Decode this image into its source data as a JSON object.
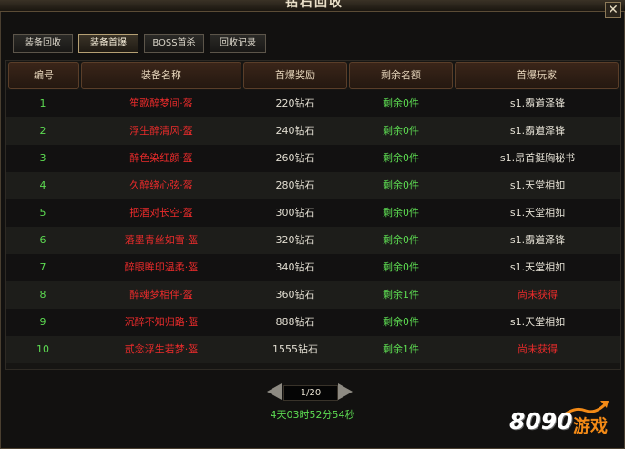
{
  "window": {
    "title": "钻石回收",
    "close_symbol": "✕"
  },
  "tabs": [
    {
      "label": "装备回收",
      "active": false
    },
    {
      "label": "装备首爆",
      "active": true
    },
    {
      "label": "BOSS首杀",
      "active": false
    },
    {
      "label": "回收记录",
      "active": false
    }
  ],
  "table": {
    "headers": [
      "编号",
      "装备名称",
      "首爆奖励",
      "剩余名额",
      "首爆玩家"
    ],
    "rows": [
      {
        "no": "1",
        "name": "笙歌醉梦间·盔",
        "reward": "220钻石",
        "remain": "剩余0件",
        "player": "s1.霸道泽锋"
      },
      {
        "no": "2",
        "name": "浮生醉清风·盔",
        "reward": "240钻石",
        "remain": "剩余0件",
        "player": "s1.霸道泽锋"
      },
      {
        "no": "3",
        "name": "醉色染红颜·盔",
        "reward": "260钻石",
        "remain": "剩余0件",
        "player": "s1.昂首挺胸秘书"
      },
      {
        "no": "4",
        "name": "久醉绕心弦·盔",
        "reward": "280钻石",
        "remain": "剩余0件",
        "player": "s1.天堂相如"
      },
      {
        "no": "5",
        "name": "把酒对长空·盔",
        "reward": "300钻石",
        "remain": "剩余0件",
        "player": "s1.天堂相如"
      },
      {
        "no": "6",
        "name": "落墨青丝如雪·盔",
        "reward": "320钻石",
        "remain": "剩余0件",
        "player": "s1.霸道泽锋"
      },
      {
        "no": "7",
        "name": "醉眼眸印温柔·盔",
        "reward": "340钻石",
        "remain": "剩余0件",
        "player": "s1.天堂相如"
      },
      {
        "no": "8",
        "name": "醉魂梦相伴·盔",
        "reward": "360钻石",
        "remain": "剩余1件",
        "player": "尚未获得"
      },
      {
        "no": "9",
        "name": "沉醉不知归路·盔",
        "reward": "888钻石",
        "remain": "剩余0件",
        "player": "s1.天堂相如"
      },
      {
        "no": "10",
        "name": "贰念浮生若梦·盔",
        "reward": "1555钻石",
        "remain": "剩余1件",
        "player": "尚未获得"
      }
    ]
  },
  "pager": {
    "text": "1/20"
  },
  "countdown": "4天03时52分54秒",
  "logo": {
    "number": "8090",
    "word": "游戏"
  },
  "colors": {
    "green": "#5ddc52",
    "red": "#ea2b2b",
    "logo_orange": "#f38a16"
  }
}
